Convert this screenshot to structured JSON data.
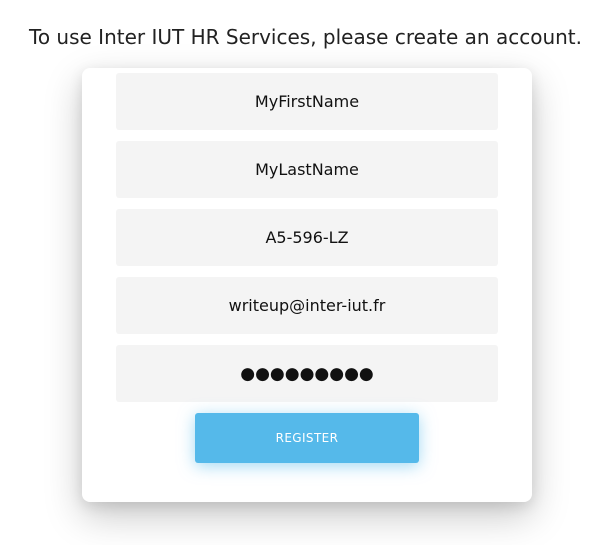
{
  "page": {
    "heading": "To use Inter IUT HR Services, please create an account."
  },
  "form": {
    "first_name": "MyFirstName",
    "last_name": "MyLastName",
    "id_code": "A5-596-LZ",
    "email": "writeup@inter-iut.fr",
    "password_mask": "●●●●●●●●●",
    "register_label": "REGISTER"
  },
  "colors": {
    "accent": "#55b9ea",
    "field_bg": "#f4f4f4",
    "text": "#222222"
  }
}
